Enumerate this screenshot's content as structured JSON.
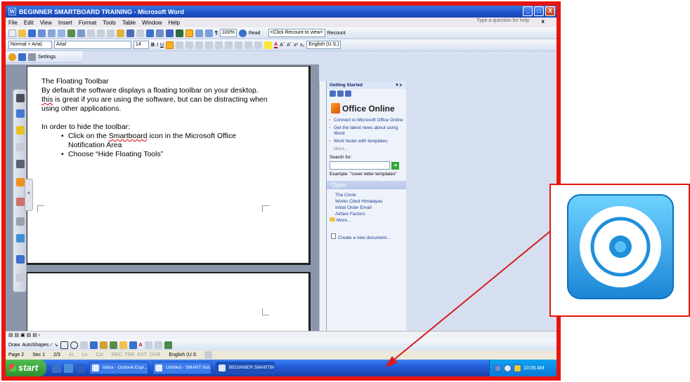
{
  "window": {
    "title": "BEGINNER SMARTBOARD TRAINING - Microsoft Word",
    "minimize": "_",
    "maximize": "□",
    "close": "X"
  },
  "menu": {
    "items": [
      "File",
      "Edit",
      "View",
      "Insert",
      "Format",
      "Tools",
      "Table",
      "Window",
      "Help"
    ],
    "help_placeholder": "Type a question for help",
    "close": "x"
  },
  "toolbar": {
    "zoom": "100%",
    "read_label": "Read",
    "recount_select": "<Click Recount to view>",
    "recount_label": "Recount",
    "style": "Normal + Arial,",
    "font": "Arial",
    "font_size": "14",
    "language": "English (U.S.)",
    "settings_label": "Settings"
  },
  "document": {
    "heading": "The Floating Toolbar",
    "para1_a": "By default the software displays a floating toolbar on your desktop.",
    "para1_b_underlined": "this",
    "para1_b_rest": " is great if you are using the software, but can be distracting when using other applications.",
    "para2": "In order to hide the toolbar:",
    "bullet1_a": "Click on the ",
    "bullet1_link": "Smartboard",
    "bullet1_b": " icon in the Microsoft Office Notification Area",
    "bullet2": "Choose “Hide Floating Tools”"
  },
  "task_pane": {
    "title": "Getting Started",
    "close": "▾ x",
    "logo": "Office Online",
    "links": [
      "Connect to Microsoft Office Online",
      "Get the latest news about using Word",
      "Work faster with templates"
    ],
    "more": "More...",
    "search_label": "Search for:",
    "search_value": "",
    "example": "Example: \"cover letter templates\"",
    "open_heading": "Open",
    "files": [
      "The Circle",
      "Works Cited Himalayas",
      "Initial Order Email",
      "Airfare Factors"
    ],
    "files_more": "More...",
    "create": "Create a new document..."
  },
  "drawing_bar": {
    "draw": "Draw",
    "autoshapes": "AutoShapes"
  },
  "status": {
    "page": "Page 2",
    "sec": "Sec 1",
    "pages": "2/3",
    "at": "At",
    "ln": "Ln",
    "col": "Col",
    "rec": "REC",
    "trk": "TRK",
    "ext": "EXT",
    "ovr": "OVR",
    "lang": "English (U.S"
  },
  "taskbar": {
    "start": "start",
    "tasks": [
      "Inbox - Outlook Expr...",
      "Untitled - SMART Not...",
      "BEGINNER SMARTBO..."
    ],
    "clock": "10:05 AM"
  },
  "colors": {
    "frame": "#e8140f",
    "callout_icon_bg": "#2d9ee6",
    "arrow": "#d81b1b"
  }
}
